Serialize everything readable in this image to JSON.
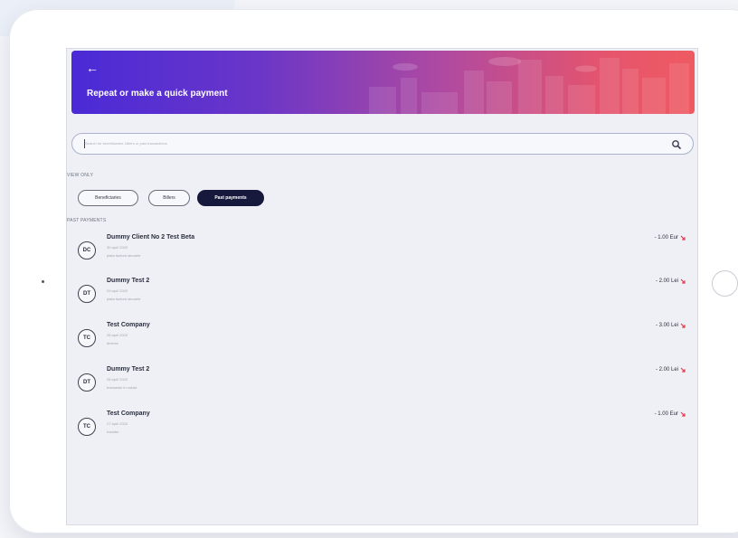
{
  "header": {
    "back_icon": "arrow-left-icon",
    "title": "Repeat or make a quick payment"
  },
  "search": {
    "placeholder": "Search for beneficiaries, billers or past transactions",
    "value": "",
    "icon": "search-icon"
  },
  "filters": {
    "label": "VIEW ONLY",
    "chips": [
      {
        "label": "Beneficiaries",
        "selected": false
      },
      {
        "label": "Billers",
        "selected": false
      },
      {
        "label": "Past payments",
        "selected": true
      }
    ]
  },
  "past_payments": {
    "label": "PAST PAYMENTS",
    "items": [
      {
        "initials": "DC",
        "name": "Dummy Client No 2 Test Beta",
        "date": "30 april 2020",
        "description": "plata factura ianuarie",
        "amount": "- 1.00 Eur"
      },
      {
        "initials": "DT",
        "name": "Dummy Test 2",
        "date": "29 april 2020",
        "description": "plata factura ianuarie",
        "amount": "- 2.00 Lei"
      },
      {
        "initials": "TC",
        "name": "Test Company",
        "date": "28 april 2020",
        "description": "diverse",
        "amount": "- 3.00 Lei"
      },
      {
        "initials": "DT",
        "name": "Dummy Test 2",
        "date": "28 april 2020",
        "description": "transacție in valuta",
        "amount": "- 2.00 Lei"
      },
      {
        "initials": "TC",
        "name": "Test Company",
        "date": "27 april 2020",
        "description": "transfer",
        "amount": "- 1.00 Eur"
      }
    ]
  },
  "colors": {
    "banner_start": "#4a2ad6",
    "banner_end": "#ef5a61",
    "chip_active": "#16193b",
    "outgoing_arrow": "#e5394a"
  }
}
